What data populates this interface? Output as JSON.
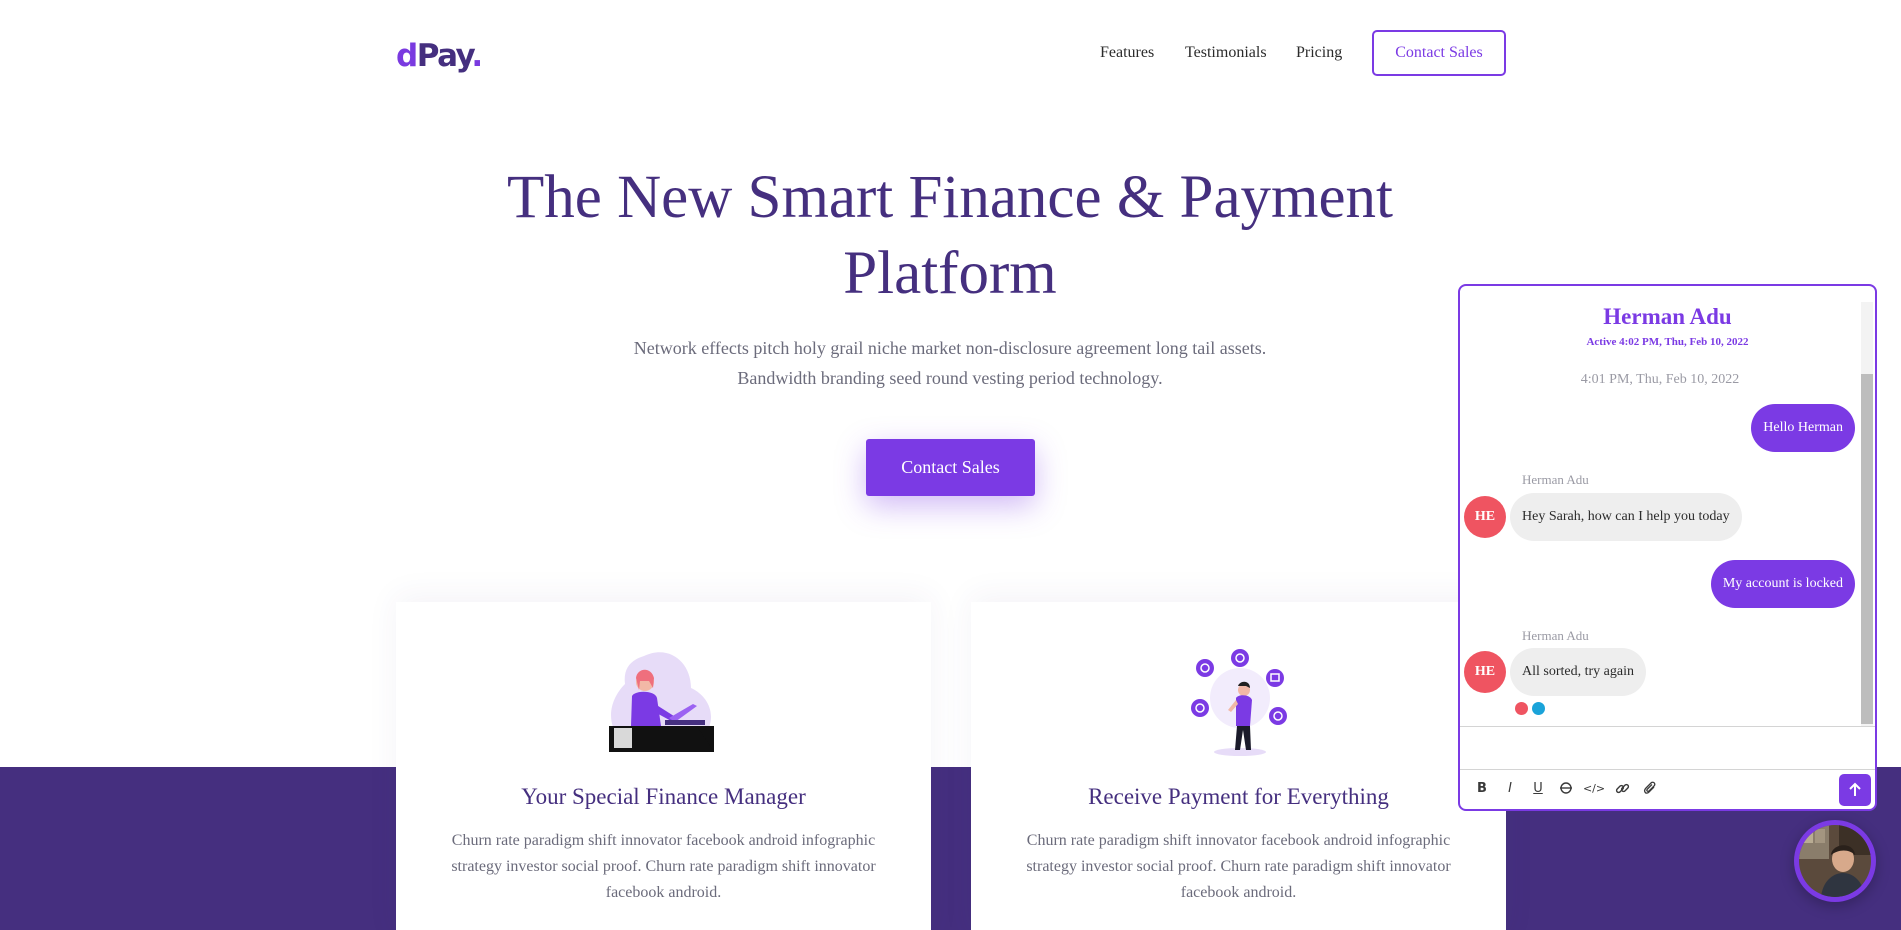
{
  "header": {
    "logo": {
      "d": "d",
      "rest": "Pay",
      "dot": "."
    },
    "nav": [
      "Features",
      "Testimonials",
      "Pricing"
    ],
    "cta_label": "Contact Sales"
  },
  "hero": {
    "title": "The New Smart Finance & Payment Platform",
    "subtitle_line1": "Network effects pitch holy grail niche market non-disclosure agreement long tail assets.",
    "subtitle_line2": "Bandwidth branding seed round vesting period technology.",
    "cta_label": "Contact Sales"
  },
  "cards": [
    {
      "title": "Your Special Finance Manager",
      "text": "Churn rate paradigm shift innovator facebook android infographic strategy investor social proof. Churn rate paradigm shift innovator facebook android.",
      "illustration": "woman-at-laptop-illustration"
    },
    {
      "title": "Receive Payment for Everything",
      "text": "Churn rate paradigm shift innovator facebook android infographic strategy investor social proof. Churn rate paradigm shift innovator facebook android.",
      "illustration": "man-with-app-icons-illustration"
    }
  ],
  "chat": {
    "agent_name": "Herman Adu",
    "status": "Active 4:02 PM, Thu, Feb 10, 2022",
    "timestamp": "4:01 PM, Thu, Feb 10, 2022",
    "messages": [
      {
        "from": "user",
        "text": "Hello Herman"
      },
      {
        "from": "agent",
        "sender": "Herman Adu",
        "avatar": "HE",
        "text": "Hey Sarah, how can I help you today"
      },
      {
        "from": "user",
        "text": "My account is locked"
      },
      {
        "from": "agent",
        "sender": "Herman Adu",
        "avatar": "HE",
        "text": "All sorted, try again"
      }
    ],
    "typing_colors": [
      "#ef5461",
      "#1aa3d9"
    ],
    "toolbar": [
      "bold-icon",
      "italic-icon",
      "underline-icon",
      "strikethrough-icon",
      "code-icon",
      "link-icon",
      "attachment-icon"
    ],
    "send_icon": "arrow-up-icon"
  },
  "colors": {
    "brand_dark": "#452f7f",
    "brand_accent": "#7b3ae4",
    "avatar_red": "#ef5461"
  }
}
